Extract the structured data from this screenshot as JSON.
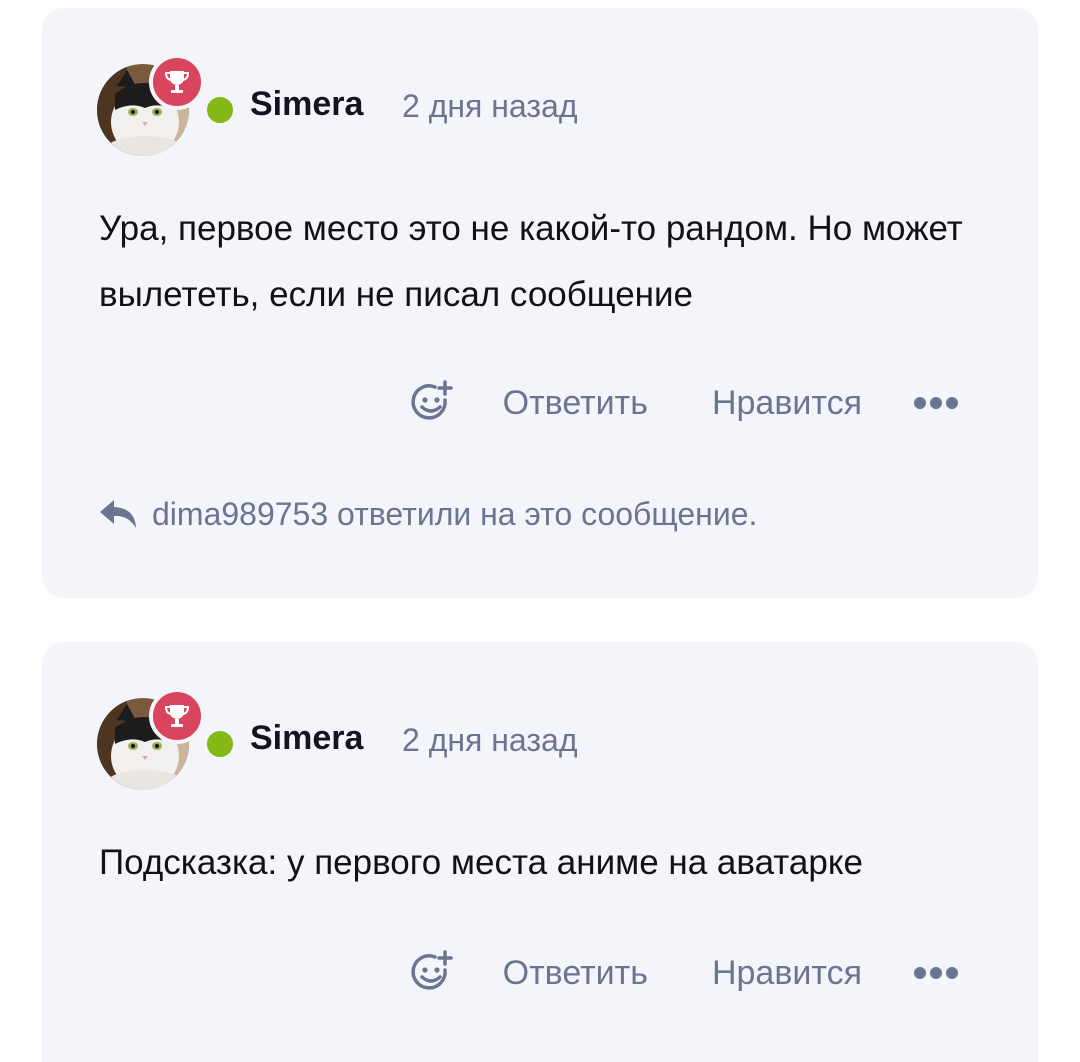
{
  "comments": [
    {
      "author": "Simera",
      "time": "2 дня назад",
      "text": "Ура, первое место это не какой-то рандом. Но может вылететь, если не писал сообщение",
      "actions": {
        "reply": "Ответить",
        "like": "Нравится"
      },
      "replied_note": "dima989753 ответили на это сообщение."
    },
    {
      "author": "Simera",
      "time": "2 дня назад",
      "text": "Подсказка: у первого места аниме на аватарке",
      "actions": {
        "reply": "Ответить",
        "like": "Нравится"
      }
    }
  ],
  "colors": {
    "badge": "#d9455f",
    "online": "#84b817",
    "muted_text": "#6b7490",
    "card_bg": "#f4f5fa"
  },
  "icons": {
    "avatar": "cat-photo",
    "badge": "trophy-icon",
    "react": "emoji-add-icon",
    "more": "more-dots-icon",
    "reply_indicator": "reply-arrow-icon"
  }
}
